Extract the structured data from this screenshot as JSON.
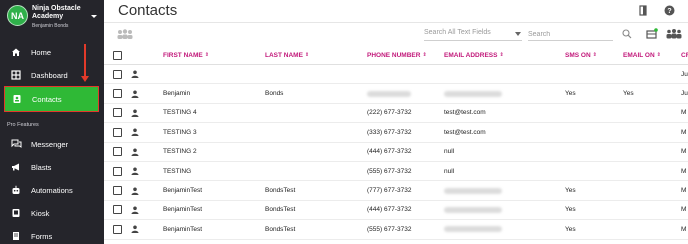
{
  "org": {
    "initials": "NA",
    "name": "Ninja Obstacle Academy",
    "user": "Benjamin Bonds"
  },
  "sidebar": {
    "items": [
      {
        "label": "Home",
        "icon": "home-icon"
      },
      {
        "label": "Dashboard",
        "icon": "dashboard-icon"
      },
      {
        "label": "Contacts",
        "icon": "contacts-icon",
        "active": true
      }
    ],
    "section": "Pro Features",
    "pro_items": [
      {
        "label": "Messenger",
        "icon": "messenger-icon"
      },
      {
        "label": "Blasts",
        "icon": "megaphone-icon"
      },
      {
        "label": "Automations",
        "icon": "robot-icon"
      },
      {
        "label": "Kiosk",
        "icon": "kiosk-icon"
      },
      {
        "label": "Forms",
        "icon": "forms-icon"
      }
    ]
  },
  "header": {
    "title": "Contacts"
  },
  "toolbar": {
    "filter_label": "Search All Text Fields",
    "search_placeholder": "Search"
  },
  "table": {
    "columns": {
      "first": "FIRST NAME",
      "last": "LAST NAME",
      "phone": "PHONE NUMBER",
      "email": "EMAIL ADDRESS",
      "sms": "SMS ON",
      "email_on": "EMAIL ON",
      "cr": "CR"
    },
    "rows": [
      {
        "first": "",
        "last": "",
        "phone": "",
        "email": "",
        "sms": "",
        "email_on": "",
        "cr": "Ju"
      },
      {
        "first": "Benjamin",
        "last": "Bonds",
        "phone": "",
        "email": "",
        "sms": "Yes",
        "email_on": "Yes",
        "cr": "Ju"
      },
      {
        "first": "TESTING 4",
        "last": "",
        "phone": "(222) 677-3732",
        "email": "test@test.com",
        "sms": "",
        "email_on": "",
        "cr": "M"
      },
      {
        "first": "TESTING 3",
        "last": "",
        "phone": "(333) 677-3732",
        "email": "test@test.com",
        "sms": "",
        "email_on": "",
        "cr": "M"
      },
      {
        "first": "TESTING 2",
        "last": "",
        "phone": "(444) 677-3732",
        "email": "null",
        "sms": "",
        "email_on": "",
        "cr": "M"
      },
      {
        "first": "TESTING",
        "last": "",
        "phone": "(555) 677-3732",
        "email": "null",
        "sms": "",
        "email_on": "",
        "cr": "M"
      },
      {
        "first": "BenjaminTest",
        "last": "BondsTest",
        "phone": "(777) 677-3732",
        "email": "",
        "sms": "Yes",
        "email_on": "",
        "cr": "M"
      },
      {
        "first": "BenjaminTest",
        "last": "BondsTest",
        "phone": "(444) 677-3732",
        "email": "",
        "sms": "Yes",
        "email_on": "",
        "cr": "M"
      },
      {
        "first": "BenjaminTest",
        "last": "BondsTest",
        "phone": "(555) 677-3732",
        "email": "",
        "sms": "Yes",
        "email_on": "",
        "cr": "M"
      }
    ]
  },
  "colors": {
    "sidebar_bg": "#25252b",
    "active_bg": "#2fb936",
    "annotation_red": "#e23a2a",
    "header_pink": "#c2187a"
  }
}
